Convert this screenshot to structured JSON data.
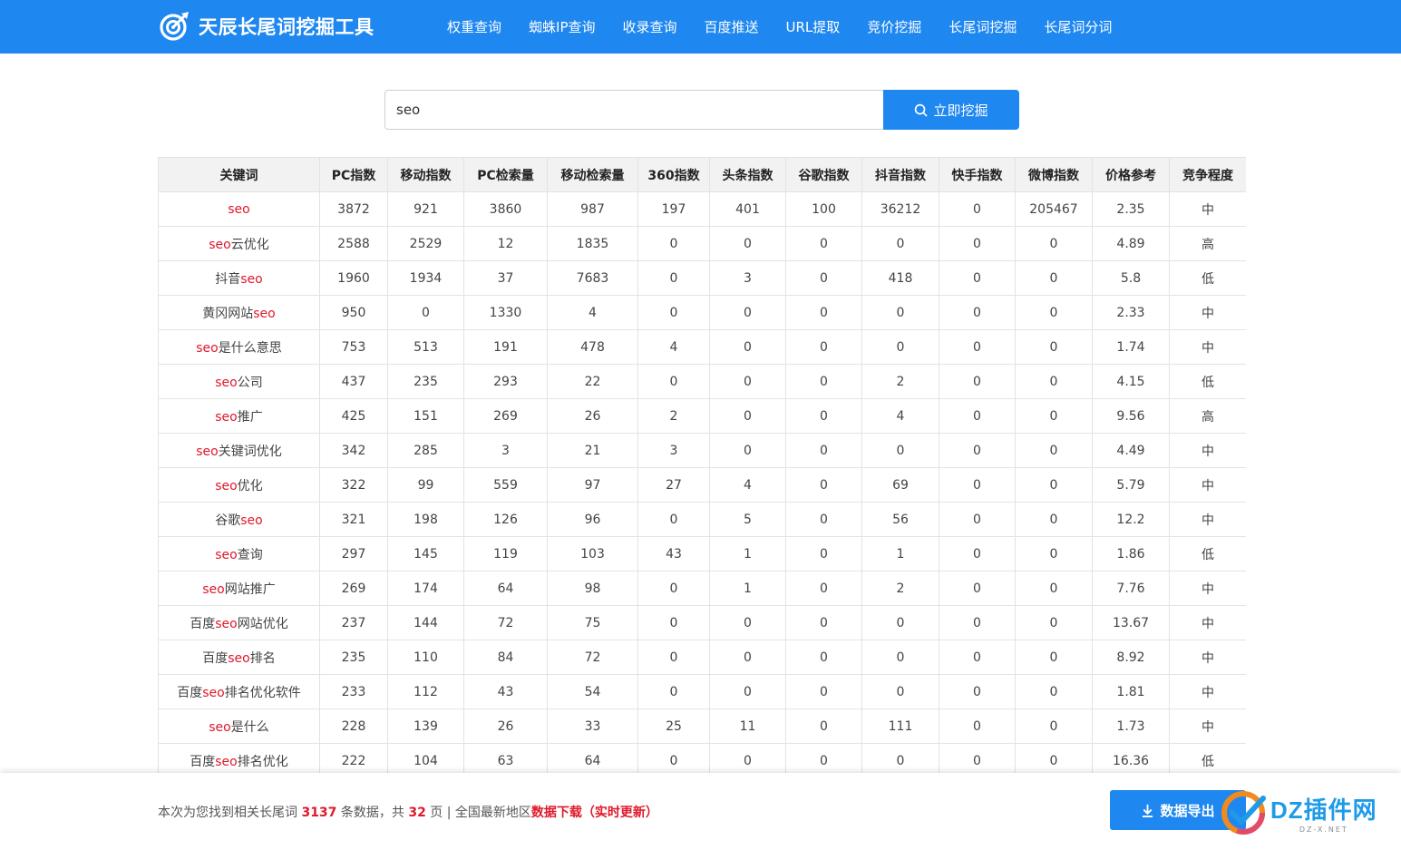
{
  "header": {
    "logo_text": "天辰长尾词挖掘工具",
    "nav": [
      "权重查询",
      "蜘蛛IP查询",
      "收录查询",
      "百度推送",
      "URL提取",
      "竞价挖掘",
      "长尾词挖掘",
      "长尾词分词"
    ]
  },
  "search": {
    "value": "seo",
    "button_label": "立即挖掘"
  },
  "table": {
    "columns": [
      "关键词",
      "PC指数",
      "移动指数",
      "PC检索量",
      "移动检索量",
      "360指数",
      "头条指数",
      "谷歌指数",
      "抖音指数",
      "快手指数",
      "微博指数",
      "价格参考",
      "竞争程度"
    ],
    "rows": [
      {
        "kw": [
          "",
          "seo",
          ""
        ],
        "cells": [
          "3872",
          "921",
          "3860",
          "987",
          "197",
          "401",
          "100",
          "36212",
          "0",
          "205467",
          "2.35",
          "中"
        ]
      },
      {
        "kw": [
          "",
          "seo",
          "云优化"
        ],
        "cells": [
          "2588",
          "2529",
          "12",
          "1835",
          "0",
          "0",
          "0",
          "0",
          "0",
          "0",
          "4.89",
          "高"
        ]
      },
      {
        "kw": [
          "抖音",
          "seo",
          ""
        ],
        "cells": [
          "1960",
          "1934",
          "37",
          "7683",
          "0",
          "3",
          "0",
          "418",
          "0",
          "0",
          "5.8",
          "低"
        ]
      },
      {
        "kw": [
          "黄冈网站",
          "seo",
          ""
        ],
        "cells": [
          "950",
          "0",
          "1330",
          "4",
          "0",
          "0",
          "0",
          "0",
          "0",
          "0",
          "2.33",
          "中"
        ]
      },
      {
        "kw": [
          "",
          "seo",
          "是什么意思"
        ],
        "cells": [
          "753",
          "513",
          "191",
          "478",
          "4",
          "0",
          "0",
          "0",
          "0",
          "0",
          "1.74",
          "中"
        ]
      },
      {
        "kw": [
          "",
          "seo",
          "公司"
        ],
        "cells": [
          "437",
          "235",
          "293",
          "22",
          "0",
          "0",
          "0",
          "2",
          "0",
          "0",
          "4.15",
          "低"
        ]
      },
      {
        "kw": [
          "",
          "seo",
          "推广"
        ],
        "cells": [
          "425",
          "151",
          "269",
          "26",
          "2",
          "0",
          "0",
          "4",
          "0",
          "0",
          "9.56",
          "高"
        ]
      },
      {
        "kw": [
          "",
          "seo",
          "关键词优化"
        ],
        "cells": [
          "342",
          "285",
          "3",
          "21",
          "3",
          "0",
          "0",
          "0",
          "0",
          "0",
          "4.49",
          "中"
        ]
      },
      {
        "kw": [
          "",
          "seo",
          "优化"
        ],
        "cells": [
          "322",
          "99",
          "559",
          "97",
          "27",
          "4",
          "0",
          "69",
          "0",
          "0",
          "5.79",
          "中"
        ]
      },
      {
        "kw": [
          "谷歌",
          "seo",
          ""
        ],
        "cells": [
          "321",
          "198",
          "126",
          "96",
          "0",
          "5",
          "0",
          "56",
          "0",
          "0",
          "12.2",
          "中"
        ]
      },
      {
        "kw": [
          "",
          "seo",
          "查询"
        ],
        "cells": [
          "297",
          "145",
          "119",
          "103",
          "43",
          "1",
          "0",
          "1",
          "0",
          "0",
          "1.86",
          "低"
        ]
      },
      {
        "kw": [
          "",
          "seo",
          "网站推广"
        ],
        "cells": [
          "269",
          "174",
          "64",
          "98",
          "0",
          "1",
          "0",
          "2",
          "0",
          "0",
          "7.76",
          "中"
        ]
      },
      {
        "kw": [
          "百度",
          "seo",
          "网站优化"
        ],
        "cells": [
          "237",
          "144",
          "72",
          "75",
          "0",
          "0",
          "0",
          "0",
          "0",
          "0",
          "13.67",
          "中"
        ]
      },
      {
        "kw": [
          "百度",
          "seo",
          "排名"
        ],
        "cells": [
          "235",
          "110",
          "84",
          "72",
          "0",
          "0",
          "0",
          "0",
          "0",
          "0",
          "8.92",
          "中"
        ]
      },
      {
        "kw": [
          "百度",
          "seo",
          "排名优化软件"
        ],
        "cells": [
          "233",
          "112",
          "43",
          "54",
          "0",
          "0",
          "0",
          "0",
          "0",
          "0",
          "1.81",
          "中"
        ]
      },
      {
        "kw": [
          "",
          "seo",
          "是什么"
        ],
        "cells": [
          "228",
          "139",
          "26",
          "33",
          "25",
          "11",
          "0",
          "111",
          "0",
          "0",
          "1.73",
          "中"
        ]
      },
      {
        "kw": [
          "百度",
          "seo",
          "排名优化"
        ],
        "cells": [
          "222",
          "104",
          "63",
          "64",
          "0",
          "0",
          "0",
          "0",
          "0",
          "0",
          "16.36",
          "低"
        ]
      }
    ]
  },
  "footer": {
    "text_1": "本次为您找到相关长尾词",
    "count": "3137",
    "text_2": "条数据，共",
    "pages": "32",
    "text_3": "页 | 全国最新地区",
    "download_label": "数据下载（实时更新）",
    "export_label": "数据导出"
  },
  "watermark": {
    "main": "DZ插件网",
    "sub": "DZ-X.NET"
  },
  "colors": {
    "accent": "#1e87f0",
    "highlight": "#e0182a"
  }
}
